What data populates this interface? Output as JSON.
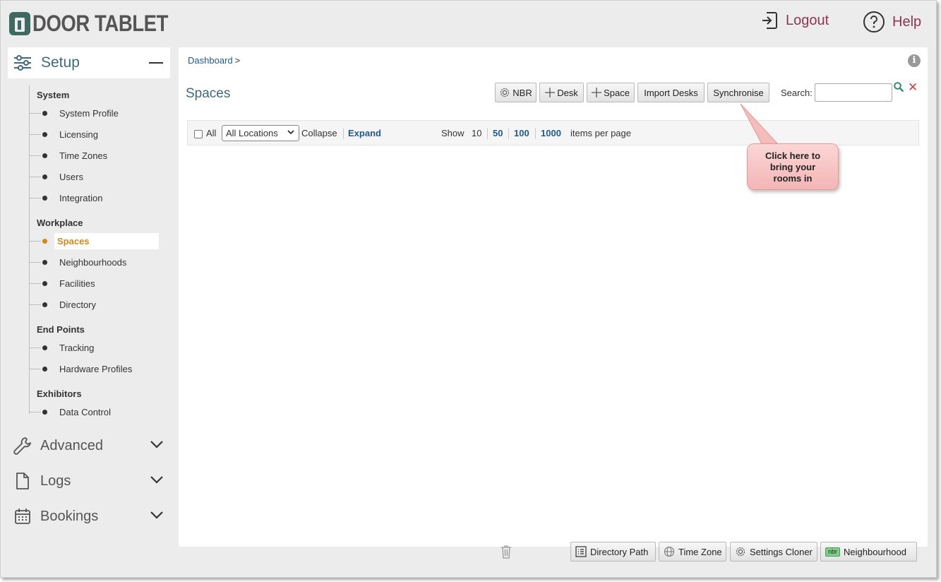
{
  "header": {
    "logo_text": "DOOR TABLET",
    "logout_label": "Logout",
    "help_label": "Help"
  },
  "sidebar": {
    "setup_label": "Setup",
    "sections": [
      {
        "title": "System",
        "items": [
          "System Profile",
          "Licensing",
          "Time Zones",
          "Users",
          "Integration"
        ]
      },
      {
        "title": "Workplace",
        "items": [
          "Spaces",
          "Neighbourhoods",
          "Facilities",
          "Directory"
        ]
      },
      {
        "title": "End Points",
        "items": [
          "Tracking",
          "Hardware Profiles"
        ]
      },
      {
        "title": "Exhibitors",
        "items": [
          "Data Control"
        ]
      }
    ],
    "active_item": "Spaces",
    "menus": [
      "Advanced",
      "Logs",
      "Bookings"
    ]
  },
  "main": {
    "breadcrumb": "Dashboard",
    "breadcrumb_sep": ">",
    "title": "Spaces",
    "buttons": {
      "nbr": "NBR",
      "desk": "Desk",
      "space": "Space",
      "import_desks": "Import Desks",
      "synchronise": "Synchronise"
    },
    "search_label": "Search:",
    "search_value": "",
    "toolbar": {
      "all_label": "All",
      "location_select": "All Locations",
      "collapse": "Collapse",
      "expand": "Expand",
      "show": "Show",
      "page_sizes": [
        "10",
        "50",
        "100",
        "1000"
      ],
      "items_per_page": "items per page"
    },
    "callout": [
      "Click here to",
      "bring your",
      "rooms in"
    ]
  },
  "footer": {
    "directory_path": "Directory Path",
    "time_zone": "Time Zone",
    "settings_cloner": "Settings Cloner",
    "neighbourhood": "Neighbourhood",
    "nbr_chip": "nbr"
  },
  "colors": {
    "accent_link": "#1e5a8e",
    "brand_green": "#3d6b62",
    "header_link": "#8e3456",
    "active_item": "#cc8a1d",
    "callout_bg": "#f4b5b5"
  }
}
